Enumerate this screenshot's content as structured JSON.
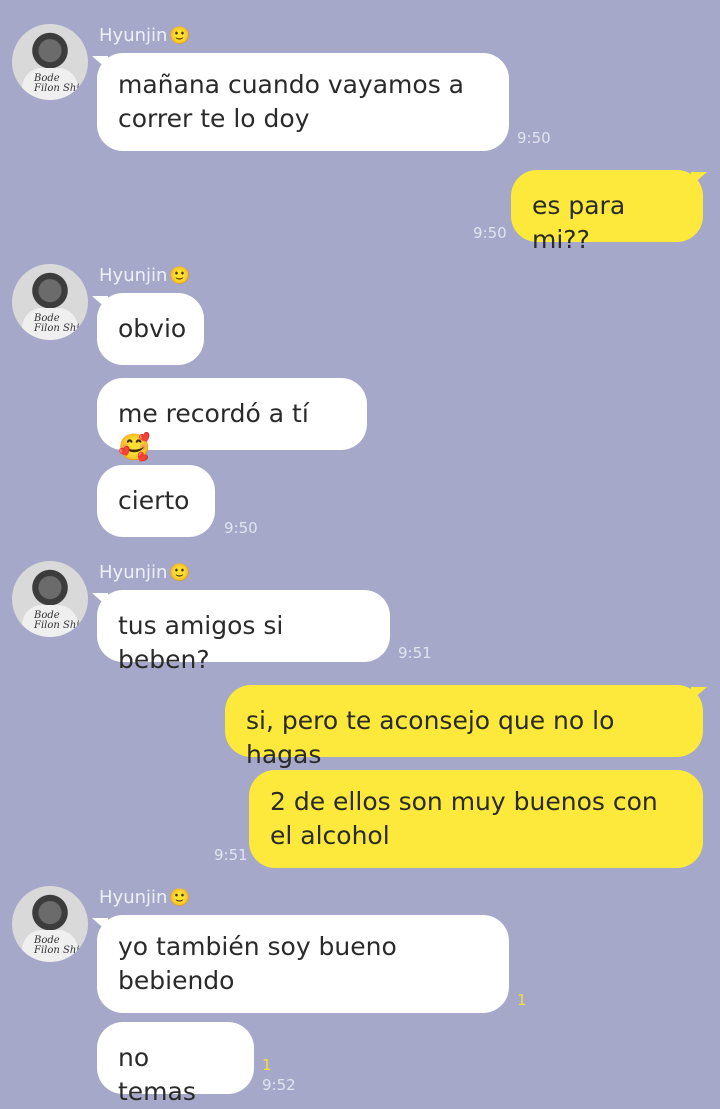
{
  "contact": {
    "name": "Hyunjin",
    "name_emoji": "🙂",
    "avatar_shirt_text": "Bode Filon Shi"
  },
  "messages": [
    {
      "from": "them",
      "text": "mañana cuando vayamos a correr te lo doy",
      "time": "9:50"
    },
    {
      "from": "me",
      "text": "es para mi??",
      "time": "9:50"
    },
    {
      "from": "them",
      "text": "obvio"
    },
    {
      "from": "them",
      "text": "me recordó a tí",
      "emoji": "🥰"
    },
    {
      "from": "them",
      "text": "cierto",
      "time": "9:50"
    },
    {
      "from": "them",
      "text": "tus amigos si beben?",
      "time": "9:51"
    },
    {
      "from": "me",
      "text": "si, pero te aconsejo que no lo hagas"
    },
    {
      "from": "me",
      "text": "2 de ellos son muy buenos con el alcohol",
      "time": "9:51"
    },
    {
      "from": "them",
      "text": "yo también soy bueno bebiendo",
      "read": "1"
    },
    {
      "from": "them",
      "text": "no temas",
      "read": "1",
      "time": "9:52"
    }
  ],
  "colors": {
    "background": "#a5a8c8",
    "incoming": "#ffffff",
    "outgoing": "#fde93b"
  }
}
